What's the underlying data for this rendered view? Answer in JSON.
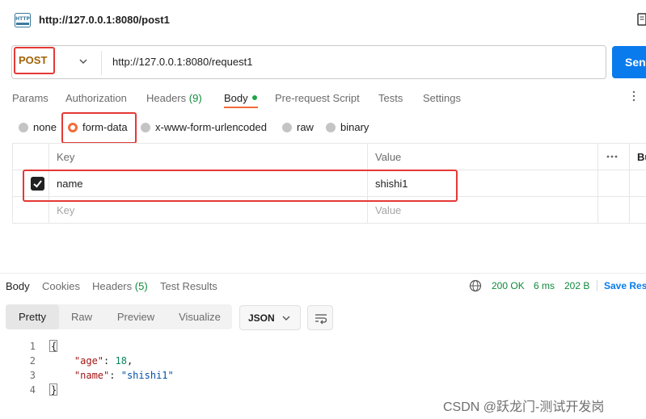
{
  "request": {
    "title": "http://127.0.0.1:8080/post1",
    "method": "POST",
    "url": "http://127.0.0.1:8080/request1",
    "send_label": "Send"
  },
  "tabs": [
    {
      "label": "Params"
    },
    {
      "label": "Authorization"
    },
    {
      "label": "Headers",
      "count": "(9)"
    },
    {
      "label": "Body"
    },
    {
      "label": "Pre-request Script"
    },
    {
      "label": "Tests"
    },
    {
      "label": "Settings"
    }
  ],
  "body_types": [
    "none",
    "form-data",
    "x-www-form-urlencoded",
    "raw",
    "binary"
  ],
  "selected_body_type": "form-data",
  "kv_table": {
    "headers": [
      "Key",
      "Value",
      "Bu"
    ],
    "rows": [
      {
        "checked": true,
        "key": "name",
        "value": "shishi1"
      }
    ],
    "placeholder": {
      "key": "Key",
      "value": "Value"
    }
  },
  "response": {
    "tabs": [
      {
        "label": "Body"
      },
      {
        "label": "Cookies"
      },
      {
        "label": "Headers",
        "count": "(5)"
      },
      {
        "label": "Test Results"
      }
    ],
    "status": "200 OK",
    "time": "6 ms",
    "size": "202 B",
    "save_label": "Save Res",
    "views": [
      "Pretty",
      "Raw",
      "Preview",
      "Visualize"
    ],
    "format": "JSON",
    "lines": [
      "1",
      "2",
      "3",
      "4"
    ],
    "json": {
      "open": "{",
      "age_key": "\"age\"",
      "age_value": "18",
      "name_key": "\"name\"",
      "name_value": "\"shishi1\"",
      "close": "}"
    }
  },
  "watermark": "CSDN @跃龙门-测试开发岗",
  "colors": {
    "accent": "#f26b3a",
    "send": "#097bed",
    "status_ok": "#0f8a3b",
    "annotation": "#e53935"
  }
}
